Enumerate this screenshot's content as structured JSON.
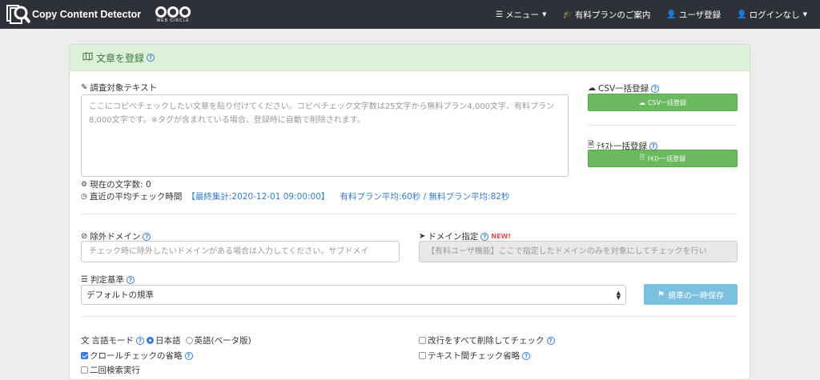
{
  "navbar": {
    "brand": "Copy Content Detector",
    "partner_logo_text": "WEB CIRCLE",
    "items": [
      {
        "icon": "menu-icon",
        "label": "メニュー"
      },
      {
        "icon": "graduation-cap-icon",
        "label": "有料プランのご案内"
      },
      {
        "icon": "user-icon",
        "label": "ユーザ登録"
      },
      {
        "icon": "user-icon",
        "label": "ログインなし"
      }
    ]
  },
  "panel": {
    "title": "文章を登録",
    "target_text": {
      "label": "調査対象テキスト",
      "placeholder": "ここにコピペチェックしたい文章を貼り付けてください。コピペチェック文字数は25文字から無料プラン4,000文字、有料プラン8,000文字です。※タグが含まれている場合、登録時に自動で削除されます。"
    },
    "char_count": "現在の文字数: 0",
    "avg_time": {
      "label": "直近の平均チェック時間",
      "last_aggregation": "【最終集計:2020-12-01 09:00:00】",
      "plans": "有料プラン平均:60秒 / 無料プラン平均:82秒"
    },
    "csv_bulk": {
      "label": "CSV一括登録",
      "button": "CSV一括登録"
    },
    "text_bulk": {
      "label": "ﾃｷｽﾄ一括登録",
      "button": "ﾃｷｽﾄ一括登録"
    },
    "exclude_domain": {
      "label": "除外ドメイン",
      "placeholder": "チェック時に除外したいドメインがある場合は入力してください。サブドメイ"
    },
    "domain_specify": {
      "label": "ドメイン指定",
      "badge": "NEW!",
      "placeholder": "【有料ユーザ機能】ここで指定したドメインのみを対象にしてチェックを行い"
    },
    "criteria": {
      "label": "判定基準",
      "selected": "デフォルトの規準",
      "save_button": "規準の一時保存"
    },
    "options": {
      "language_label": "言語モード",
      "lang_ja": "日本語",
      "lang_en": "英語(ベータ版)",
      "crawl_skip": "クロールチェックの省略",
      "remove_newlines": "改行をすべて削除してチェック",
      "skip_text_check": "テキスト間チェック省略",
      "partial_option": "二回検索実行"
    }
  },
  "colors": {
    "navbar_bg": "#2e3138",
    "panel_head_bg": "#dff0d8",
    "green_button": "#6bb95f",
    "blue_button": "#7cc0df",
    "link_blue": "#3a7bc8",
    "new_red": "#d9534f"
  }
}
